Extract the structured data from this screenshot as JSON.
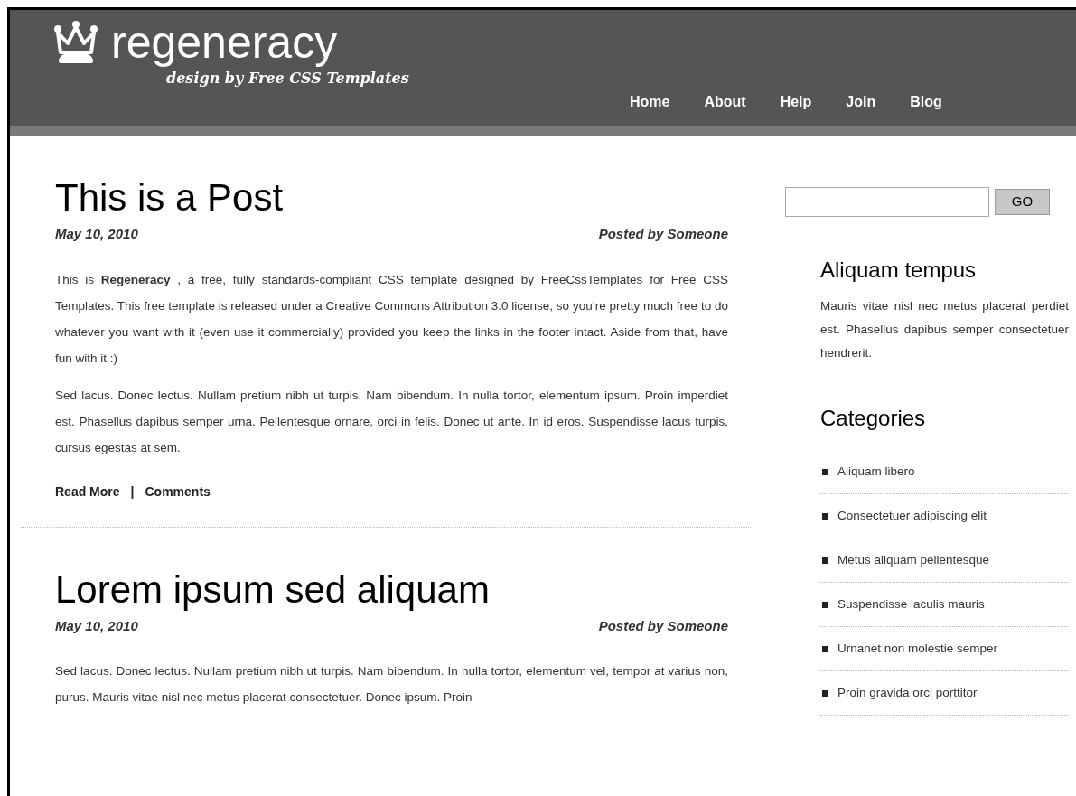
{
  "header": {
    "logo": "regeneracy",
    "tagline": "design by Free CSS Templates",
    "nav": [
      {
        "label": "Home"
      },
      {
        "label": "About"
      },
      {
        "label": "Help"
      },
      {
        "label": "Join"
      },
      {
        "label": "Blog"
      }
    ]
  },
  "posts": [
    {
      "title": "This is a Post",
      "date": "May 10, 2010",
      "author": "Posted by Someone",
      "paragraphs": [
        "This is **Regeneracy** , a free, fully standards-compliant CSS template designed by FreeCssTemplates for Free CSS Templates. This free template is released under a Creative Commons Attribution 3.0 license, so you’re pretty much free to do whatever you want with it (even use it commercially) provided you keep the links in the footer intact. Aside from that, have fun with it :)",
        "Sed lacus. Donec lectus. Nullam pretium nibh ut turpis. Nam bibendum. In nulla tortor, elementum ipsum. Proin imperdiet est. Phasellus dapibus semper urna. Pellentesque ornare, orci in felis. Donec ut ante. In id eros. Suspendisse lacus turpis, cursus egestas at sem."
      ],
      "links": [
        "Read More",
        "Comments"
      ],
      "separator": "|"
    },
    {
      "title": "Lorem ipsum sed aliquam",
      "date": "May 10, 2010",
      "author": "Posted by Someone",
      "paragraphs": [
        "Sed lacus. Donec lectus. Nullam pretium nibh ut turpis. Nam bibendum. In nulla tortor, elementum vel, tempor at varius non, purus. Mauris vitae nisl nec metus placerat consectetuer. Donec ipsum. Proin"
      ]
    }
  ],
  "sidebar": {
    "search": {
      "button": "GO"
    },
    "sections": [
      {
        "kind": "text",
        "title": "Aliquam tempus",
        "text": "Mauris vitae nisl nec metus placerat perdiet est. Phasellus dapibus semper consectetuer hendrerit."
      },
      {
        "kind": "list",
        "title": "Categories",
        "items": [
          "Aliquam libero",
          "Consectetuer adipiscing elit",
          "Metus aliquam pellentesque",
          "Suspendisse iaculis mauris",
          "Urnanet non molestie semper",
          "Proin gravida orci porttitor"
        ]
      }
    ]
  }
}
